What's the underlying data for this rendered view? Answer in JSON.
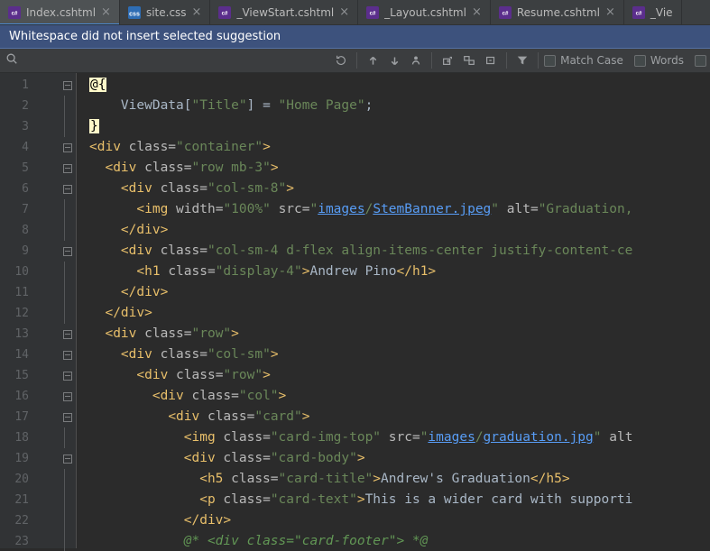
{
  "tabs": [
    {
      "label": "Index.cshtml",
      "active": true,
      "filetype": "cshtml"
    },
    {
      "label": "site.css",
      "active": false,
      "filetype": "css"
    },
    {
      "label": "_ViewStart.cshtml",
      "active": false,
      "filetype": "cshtml"
    },
    {
      "label": "_Layout.cshtml",
      "active": false,
      "filetype": "cshtml"
    },
    {
      "label": "Resume.cshtml",
      "active": false,
      "filetype": "cshtml"
    },
    {
      "label": "_Vie",
      "active": false,
      "filetype": "cshtml",
      "truncated": true
    }
  ],
  "banner": {
    "message": "Whitespace did not insert selected suggestion"
  },
  "find": {
    "placeholder": "",
    "match_case_label": "Match Case",
    "words_label": "Words"
  },
  "code": {
    "lines": [
      {
        "n": 1,
        "indent": 0,
        "tokens": [
          {
            "t": "razor",
            "v": "@{"
          }
        ]
      },
      {
        "n": 2,
        "indent": 4,
        "tokens": [
          {
            "t": "txt",
            "v": "ViewData["
          },
          {
            "t": "st",
            "v": "\"Title\""
          },
          {
            "t": "txt",
            "v": "] = "
          },
          {
            "t": "st",
            "v": "\"Home Page\""
          },
          {
            "t": "txt",
            "v": ";"
          }
        ]
      },
      {
        "n": 3,
        "indent": 0,
        "tokens": [
          {
            "t": "razor",
            "v": "}"
          }
        ]
      },
      {
        "n": 4,
        "indent": 0,
        "tokens": [
          {
            "t": "tg",
            "v": "<div "
          },
          {
            "t": "at",
            "v": "class="
          },
          {
            "t": "st",
            "v": "\"container\""
          },
          {
            "t": "tg",
            "v": ">"
          }
        ]
      },
      {
        "n": 5,
        "indent": 2,
        "tokens": [
          {
            "t": "tg",
            "v": "<div "
          },
          {
            "t": "at",
            "v": "class="
          },
          {
            "t": "st",
            "v": "\"row mb-3\""
          },
          {
            "t": "tg",
            "v": ">"
          }
        ]
      },
      {
        "n": 6,
        "indent": 4,
        "tokens": [
          {
            "t": "tg",
            "v": "<div "
          },
          {
            "t": "at",
            "v": "class="
          },
          {
            "t": "st",
            "v": "\"col-sm-8\""
          },
          {
            "t": "tg",
            "v": ">"
          }
        ]
      },
      {
        "n": 7,
        "indent": 6,
        "tokens": [
          {
            "t": "tg",
            "v": "<img "
          },
          {
            "t": "at",
            "v": "width="
          },
          {
            "t": "st",
            "v": "\"100%\""
          },
          {
            "t": "tg",
            "v": " "
          },
          {
            "t": "at",
            "v": "src="
          },
          {
            "t": "st",
            "v": "\""
          },
          {
            "t": "lk",
            "v": "images"
          },
          {
            "t": "st",
            "v": "/"
          },
          {
            "t": "lk",
            "v": "StemBanner.jpeg"
          },
          {
            "t": "st",
            "v": "\""
          },
          {
            "t": "tg",
            "v": " "
          },
          {
            "t": "at",
            "v": "alt="
          },
          {
            "t": "st",
            "v": "\"Graduation,"
          }
        ]
      },
      {
        "n": 8,
        "indent": 4,
        "tokens": [
          {
            "t": "tg",
            "v": "</div>"
          }
        ]
      },
      {
        "n": 9,
        "indent": 4,
        "tokens": [
          {
            "t": "tg",
            "v": "<div "
          },
          {
            "t": "at",
            "v": "class="
          },
          {
            "t": "st",
            "v": "\"col-sm-4 d-flex align-items-center justify-content-ce"
          }
        ]
      },
      {
        "n": 10,
        "indent": 6,
        "tokens": [
          {
            "t": "tg",
            "v": "<h1 "
          },
          {
            "t": "at",
            "v": "class="
          },
          {
            "t": "st",
            "v": "\"display-4\""
          },
          {
            "t": "tg",
            "v": ">"
          },
          {
            "t": "txt",
            "v": "Andrew Pino"
          },
          {
            "t": "tg",
            "v": "</h1>"
          }
        ]
      },
      {
        "n": 11,
        "indent": 4,
        "tokens": [
          {
            "t": "tg",
            "v": "</div>"
          }
        ]
      },
      {
        "n": 12,
        "indent": 2,
        "tokens": [
          {
            "t": "tg",
            "v": "</div>"
          }
        ]
      },
      {
        "n": 13,
        "indent": 2,
        "tokens": [
          {
            "t": "tg",
            "v": "<div "
          },
          {
            "t": "at",
            "v": "class="
          },
          {
            "t": "st",
            "v": "\"row\""
          },
          {
            "t": "tg",
            "v": ">"
          }
        ]
      },
      {
        "n": 14,
        "indent": 4,
        "tokens": [
          {
            "t": "tg",
            "v": "<div "
          },
          {
            "t": "at",
            "v": "class="
          },
          {
            "t": "st",
            "v": "\"col-sm\""
          },
          {
            "t": "tg",
            "v": ">"
          }
        ]
      },
      {
        "n": 15,
        "indent": 6,
        "tokens": [
          {
            "t": "tg",
            "v": "<div "
          },
          {
            "t": "at",
            "v": "class="
          },
          {
            "t": "st",
            "v": "\"row\""
          },
          {
            "t": "tg",
            "v": ">"
          }
        ]
      },
      {
        "n": 16,
        "indent": 8,
        "tokens": [
          {
            "t": "tg",
            "v": "<div "
          },
          {
            "t": "at",
            "v": "class="
          },
          {
            "t": "st",
            "v": "\"col\""
          },
          {
            "t": "tg",
            "v": ">"
          }
        ]
      },
      {
        "n": 17,
        "indent": 10,
        "tokens": [
          {
            "t": "tg",
            "v": "<div "
          },
          {
            "t": "at",
            "v": "class="
          },
          {
            "t": "st",
            "v": "\"card\""
          },
          {
            "t": "tg",
            "v": ">"
          }
        ]
      },
      {
        "n": 18,
        "indent": 12,
        "tokens": [
          {
            "t": "tg",
            "v": "<img "
          },
          {
            "t": "at",
            "v": "class="
          },
          {
            "t": "st",
            "v": "\"card-img-top\""
          },
          {
            "t": "tg",
            "v": " "
          },
          {
            "t": "at",
            "v": "src="
          },
          {
            "t": "st",
            "v": "\""
          },
          {
            "t": "lk",
            "v": "images"
          },
          {
            "t": "st",
            "v": "/"
          },
          {
            "t": "lk",
            "v": "graduation.jpg"
          },
          {
            "t": "st",
            "v": "\""
          },
          {
            "t": "tg",
            "v": " "
          },
          {
            "t": "at",
            "v": "alt"
          }
        ]
      },
      {
        "n": 19,
        "indent": 12,
        "tokens": [
          {
            "t": "tg",
            "v": "<div "
          },
          {
            "t": "at",
            "v": "class="
          },
          {
            "t": "st",
            "v": "\"card-body\""
          },
          {
            "t": "tg",
            "v": ">"
          }
        ]
      },
      {
        "n": 20,
        "indent": 14,
        "tokens": [
          {
            "t": "tg",
            "v": "<h5 "
          },
          {
            "t": "at",
            "v": "class="
          },
          {
            "t": "st",
            "v": "\"card-title\""
          },
          {
            "t": "tg",
            "v": ">"
          },
          {
            "t": "txt",
            "v": "Andrew's Graduation"
          },
          {
            "t": "tg",
            "v": "</h5>"
          }
        ]
      },
      {
        "n": 21,
        "indent": 14,
        "tokens": [
          {
            "t": "tg",
            "v": "<p "
          },
          {
            "t": "at",
            "v": "class="
          },
          {
            "t": "st",
            "v": "\"card-text\""
          },
          {
            "t": "tg",
            "v": ">"
          },
          {
            "t": "txt",
            "v": "This is a wider card with supporti"
          }
        ]
      },
      {
        "n": 22,
        "indent": 12,
        "tokens": [
          {
            "t": "tg",
            "v": "</div>"
          }
        ]
      },
      {
        "n": 23,
        "indent": 12,
        "tokens": [
          {
            "t": "cmt",
            "v": "@* <div class=\"card-footer\"> *@"
          }
        ]
      }
    ]
  }
}
